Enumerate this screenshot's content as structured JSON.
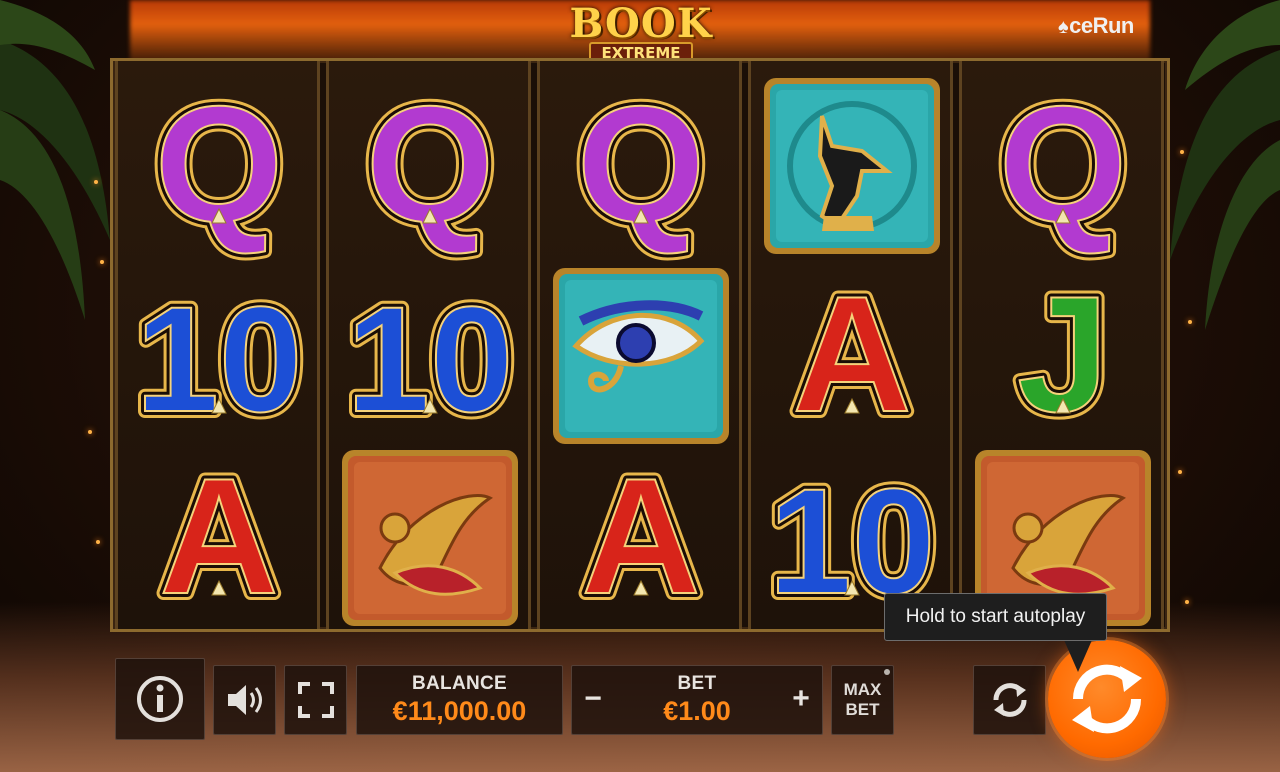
{
  "header": {
    "logo_line1": "BOOK",
    "logo_line2": "EXTREME",
    "brand": "ceRun",
    "brand_icon": "spade-icon"
  },
  "reels": {
    "columns": [
      [
        "Q",
        "10",
        "A"
      ],
      [
        "Q",
        "10",
        "winged-goddess"
      ],
      [
        "Q",
        "eye-of-horus",
        "A"
      ],
      [
        "anubis",
        "A",
        "10"
      ],
      [
        "Q",
        "J",
        "winged-goddess"
      ]
    ],
    "colors": {
      "Q": "#b23ad0",
      "10": "#1c4fd6",
      "A": "#d8241a",
      "J": "#2aa52a",
      "gold": "#e7b64a"
    }
  },
  "controls": {
    "info_icon": "info-icon",
    "sound_icon": "speaker-icon",
    "fullscreen_icon": "fullscreen-icon",
    "balance_label": "BALANCE",
    "balance_value": "€11,000.00",
    "bet_label": "BET",
    "bet_value": "€1.00",
    "bet_minus": "−",
    "bet_plus": "+",
    "maxbet_line1": "MAX",
    "maxbet_line2": "BET",
    "autoplay_icon": "autoplay-icon",
    "spin_icon": "spin-icon",
    "tooltip": "Hold to start autoplay",
    "accent": "#ff7a10"
  }
}
